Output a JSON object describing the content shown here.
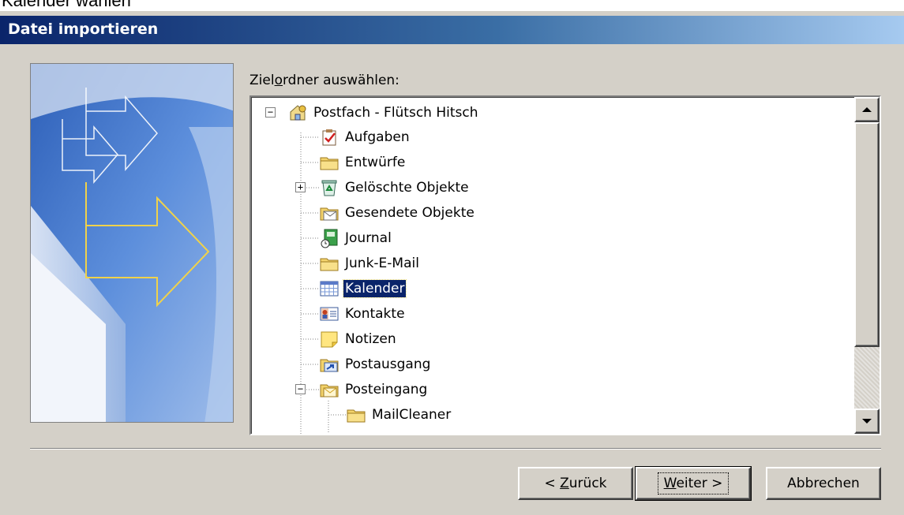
{
  "page_caption": "Kalender wählen",
  "dialog": {
    "title": "Datei importieren",
    "folder_label_pre": "Ziel",
    "folder_label_accel": "o",
    "folder_label_post": "rdner auswählen:"
  },
  "tree": {
    "root": {
      "label": "Postfach - Flütsch Hitsch",
      "icon": "mailbox-home-icon",
      "expander": "−"
    },
    "items": [
      {
        "label": "Aufgaben",
        "icon": "tasks-icon"
      },
      {
        "label": "Entwürfe",
        "icon": "folder-icon"
      },
      {
        "label": "Gelöschte Objekte",
        "icon": "recycle-bin-icon",
        "expander": "+"
      },
      {
        "label": "Gesendete Objekte",
        "icon": "sent-items-icon"
      },
      {
        "label": "Journal",
        "icon": "journal-icon"
      },
      {
        "label": "Junk-E-Mail",
        "icon": "folder-icon"
      },
      {
        "label": "Kalender",
        "icon": "calendar-icon",
        "selected": true
      },
      {
        "label": "Kontakte",
        "icon": "contacts-icon"
      },
      {
        "label": "Notizen",
        "icon": "notes-icon"
      },
      {
        "label": "Postausgang",
        "icon": "outbox-icon"
      },
      {
        "label": "Posteingang",
        "icon": "inbox-icon",
        "expander": "−"
      },
      {
        "label": "MailCleaner",
        "icon": "folder-icon"
      }
    ]
  },
  "buttons": {
    "back_pre": "< ",
    "back_accel": "Z",
    "back_post": "urück",
    "next_accel": "W",
    "next_post": "eiter >",
    "cancel": "Abbrechen"
  },
  "colors": {
    "dialog_bg": "#d4d0c8",
    "titlebar_start": "#0a246a",
    "titlebar_end": "#a6caf0",
    "selection": "#0a246a"
  }
}
